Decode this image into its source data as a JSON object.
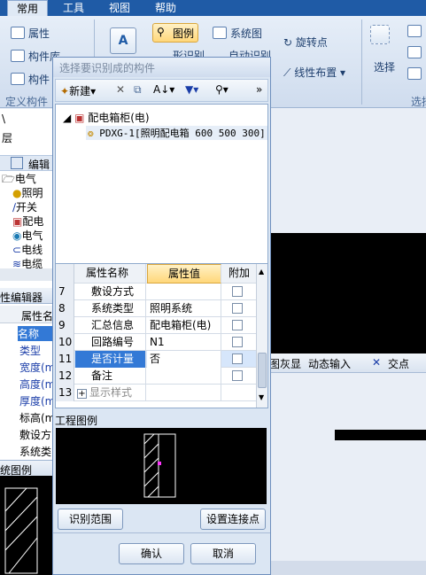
{
  "ribbon": {
    "tabs": [
      "常用",
      "工具",
      "视图",
      "帮助"
    ],
    "attr_label": "属性",
    "lib_label": "构件库",
    "comp_label": "构件",
    "define_label": "定义构件",
    "legend_btn": "图例",
    "system_btn": "系统图",
    "shape_btn": "形识别",
    "auto_btn": "自动识别",
    "rotate_btn": "旋转点",
    "line_layout": "线性布置",
    "select_label": "选择",
    "select_group": "选择"
  },
  "left_panel": {
    "row1": "\\",
    "row2": "层",
    "edit_label": "编辑",
    "tree_items": [
      "电气",
      "照明",
      "开关",
      "配电",
      "电气",
      "电线",
      "电缆"
    ],
    "editor_label": "性编辑器",
    "attr_name": "属性名",
    "props": [
      "名称",
      "类型",
      "宽度(m",
      "高度(m",
      "厚度(m",
      "标高(m",
      "敷设方",
      "系统类"
    ],
    "legend_label": "统图例"
  },
  "right_bg": {
    "gray_label": "图灰显",
    "dynamic_label": "动态输入",
    "intersect_label": "交点"
  },
  "dialog": {
    "title": "选择要识别成的构件",
    "toolbar": {
      "new_label": "新建",
      "sort_label": "A↓",
      "more_label": "»"
    },
    "tree": {
      "root": "配电箱柜(电)",
      "child": "PDXG-1[照明配电箱 600 500 300]"
    },
    "grid": {
      "headers": [
        "属性名称",
        "属性值",
        "附加"
      ],
      "rows": [
        {
          "num": "7",
          "name": "敷设方式",
          "value": ""
        },
        {
          "num": "8",
          "name": "系统类型",
          "value": "照明系统"
        },
        {
          "num": "9",
          "name": "汇总信息",
          "value": "配电箱柜(电)"
        },
        {
          "num": "10",
          "name": "回路编号",
          "value": "N1"
        },
        {
          "num": "11",
          "name": "是否计量",
          "value": "否"
        },
        {
          "num": "12",
          "name": "备注",
          "value": ""
        },
        {
          "num": "13",
          "name": "显示样式",
          "value": ""
        }
      ]
    },
    "legend_label": "工程图例",
    "range_btn": "识别范围",
    "connect_btn": "设置连接点",
    "ok_btn": "确认",
    "cancel_btn": "取消"
  },
  "colors": {
    "accent": "#1f5ba6",
    "header_highlight": "#ffd77a",
    "selection": "#3379d6"
  }
}
